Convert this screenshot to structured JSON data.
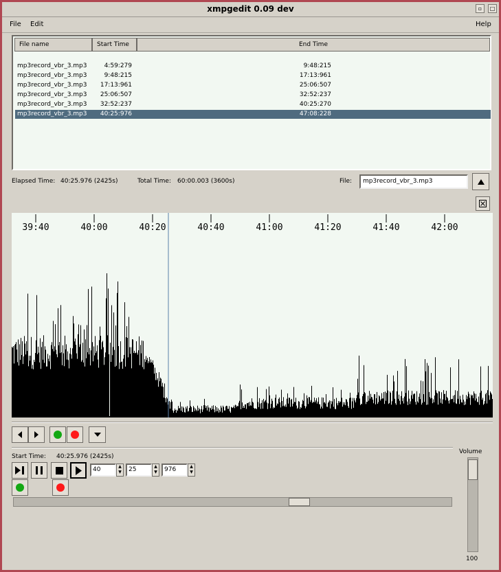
{
  "window": {
    "title": "xmpgedit 0.09 dev"
  },
  "menubar": {
    "file": "File",
    "edit": "Edit",
    "help": "Help"
  },
  "list": {
    "headers": {
      "file_name": "File name",
      "start_time": "Start Time",
      "end_time": "End Time"
    },
    "rows": [
      {
        "file": "mp3record_vbr_3.mp3",
        "start": "4:59:279",
        "end": "9:48:215"
      },
      {
        "file": "mp3record_vbr_3.mp3",
        "start": "9:48:215",
        "end": "17:13:961"
      },
      {
        "file": "mp3record_vbr_3.mp3",
        "start": "17:13:961",
        "end": "25:06:507"
      },
      {
        "file": "mp3record_vbr_3.mp3",
        "start": "25:06:507",
        "end": "32:52:237"
      },
      {
        "file": "mp3record_vbr_3.mp3",
        "start": "32:52:237",
        "end": "40:25:270"
      },
      {
        "file": "mp3record_vbr_3.mp3",
        "start": "40:25:976",
        "end": "47:08:228"
      }
    ],
    "selected_index": 5
  },
  "status": {
    "elapsed_label": "Elapsed Time:",
    "elapsed_value": "40:25.976 (2425s)",
    "total_label": "Total Time:",
    "total_value": "60:00.003 (3600s)",
    "file_label": "File:",
    "file_value": "mp3record_vbr_3.mp3"
  },
  "timeline": {
    "ticks": [
      "39:40",
      "40:00",
      "40:20",
      "40:40",
      "41:00",
      "41:20",
      "41:40",
      "42:00"
    ]
  },
  "editor": {
    "start_label": "Start Time:",
    "start_value": "40:25.976 (2425s)",
    "minutes": "40",
    "seconds": "25",
    "millis": "976",
    "volume_label": "Volume",
    "volume_value": "100"
  },
  "colors": {
    "border": "#b04752",
    "selection": "#4f6b7f",
    "green": "#13a813",
    "red": "#ff1a1a",
    "cursor_line": "#5b7fa8"
  }
}
